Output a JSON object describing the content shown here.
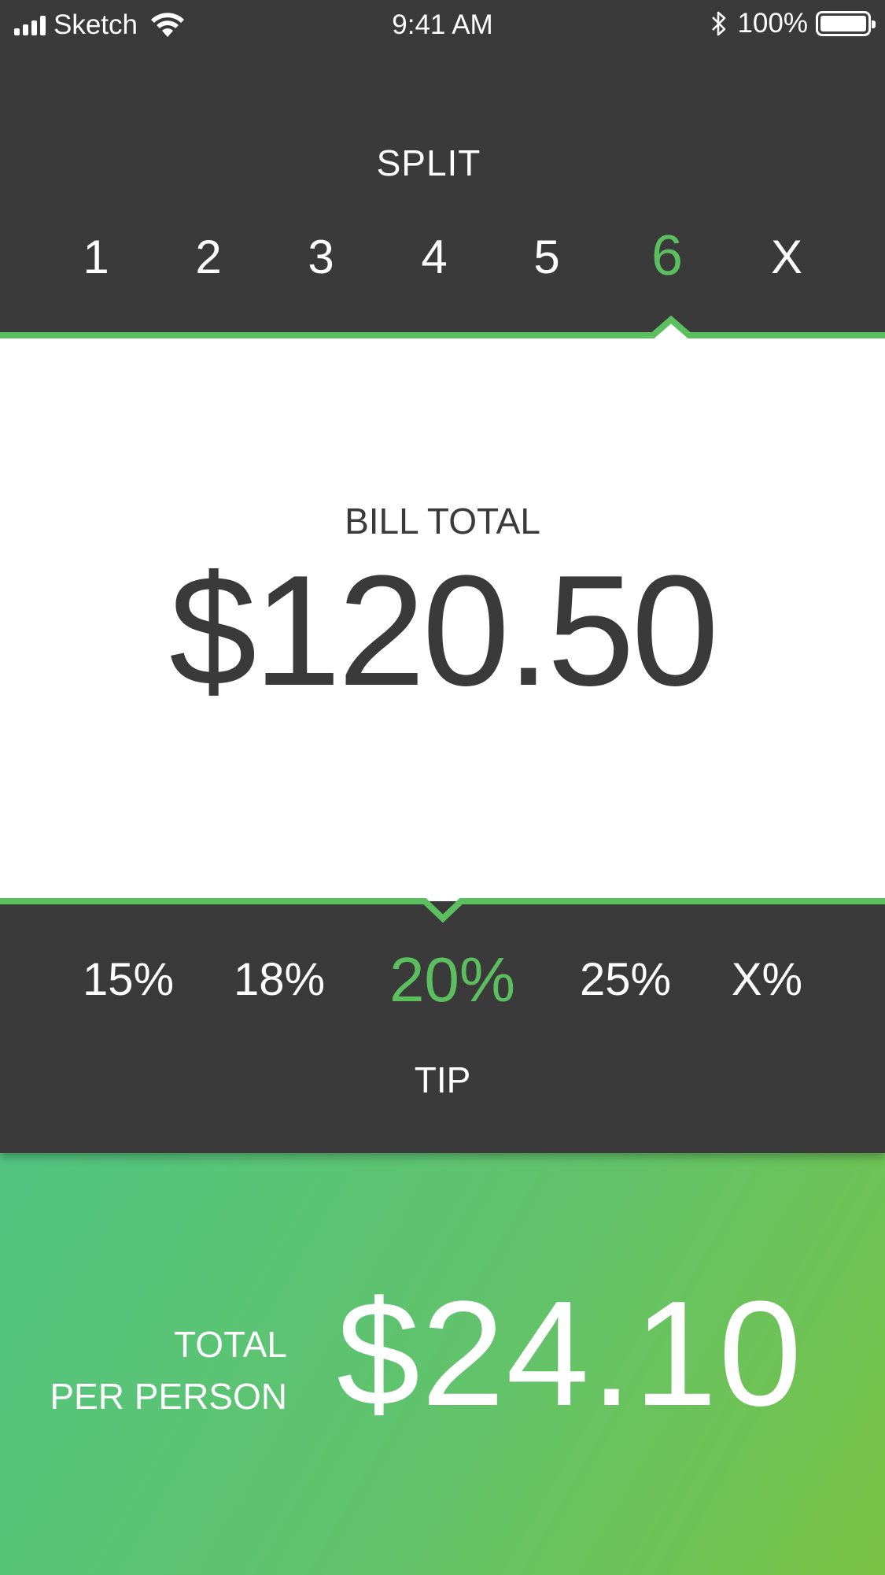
{
  "status_bar": {
    "carrier": "Sketch",
    "time": "9:41 AM",
    "battery_percent": "100%"
  },
  "split": {
    "title": "SPLIT",
    "options": [
      "1",
      "2",
      "3",
      "4",
      "5",
      "6",
      "X"
    ],
    "selected": "6"
  },
  "bill": {
    "label": "BILL TOTAL",
    "amount": "$120.50"
  },
  "tip": {
    "title": "TIP",
    "options": [
      "15%",
      "18%",
      "20%",
      "25%",
      "X%"
    ],
    "selected": "20%"
  },
  "total": {
    "label_line1": "TOTAL",
    "label_line2": "PER PERSON",
    "amount": "$24.10"
  },
  "colors": {
    "dark_background": "#3a3a3b",
    "accent_green": "#5cbf5f",
    "white": "#ffffff",
    "gradient_start": "#52c481",
    "gradient_end": "#78c244"
  }
}
